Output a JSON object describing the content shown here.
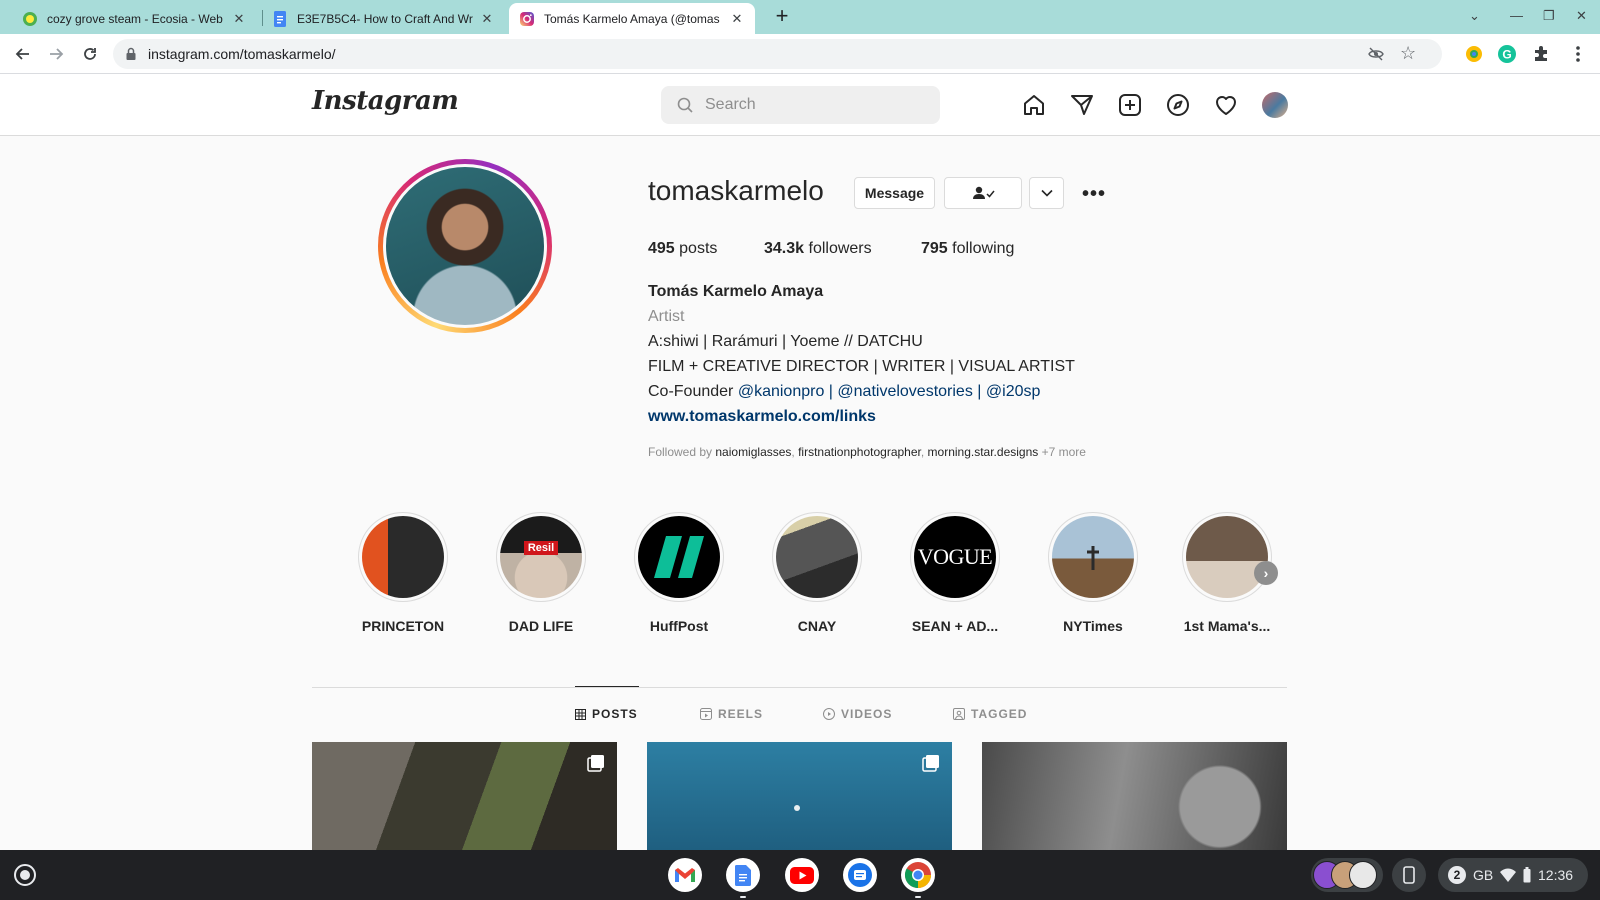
{
  "browser": {
    "tabs": [
      {
        "title": "cozy grove steam - Ecosia - Web",
        "favicon": "ecosia-icon"
      },
      {
        "title": "E3E7B5C4- How to Craft And Wr",
        "favicon": "docs-icon"
      },
      {
        "title": "Tomás Karmelo Amaya (@tomas",
        "favicon": "instagram-icon",
        "active": true
      }
    ],
    "url": "instagram.com/tomaskarmelo/"
  },
  "instagram": {
    "logo": "Instagram",
    "search_placeholder": "Search",
    "nav_icons": [
      "home-icon",
      "direct-icon",
      "new-post-icon",
      "explore-icon",
      "activity-heart-icon",
      "profile-avatar"
    ]
  },
  "profile": {
    "username": "tomaskarmelo",
    "message_label": "Message",
    "stats": {
      "posts_count": "495",
      "posts_label": "posts",
      "followers_count": "34.3k",
      "followers_label": "followers",
      "following_count": "795",
      "following_label": "following"
    },
    "full_name": "Tomás Karmelo Amaya",
    "category": "Artist",
    "bio_line1": "A:shiwi | Rarámuri | Yoeme // DATCHU",
    "bio_line2": "FILM + CREATIVE DIRECTOR | WRITER | VISUAL ARTIST",
    "bio_cofounder": "Co-Founder",
    "bio_mention1": "@kanionpro",
    "bio_sep1": "|",
    "bio_mention2": "@nativelovestories",
    "bio_sep2": "|",
    "bio_mention3": "@i20sp",
    "website": "www.tomaskarmelo.com/links",
    "followed_by_prefix": "Followed by",
    "followed_by_1": "naiomiglasses",
    "followed_by_2": "firstnationphotographer",
    "followed_by_3": "morning.star.designs",
    "followed_by_more": "+7 more"
  },
  "highlights": [
    {
      "label": "PRINCETON"
    },
    {
      "label": "DAD LIFE"
    },
    {
      "label": "HuffPost"
    },
    {
      "label": "CNAY"
    },
    {
      "label": "SEAN + AD..."
    },
    {
      "label": "NYTimes"
    },
    {
      "label": "1st Mama's..."
    }
  ],
  "highlight_marks": {
    "vogue": "VOGUE",
    "resilience": "Resil"
  },
  "profile_tabs": {
    "posts": "POSTS",
    "reels": "REELS",
    "videos": "VIDEOS",
    "tagged": "TAGGED"
  },
  "shelf": {
    "apps": [
      "gmail-icon",
      "docs-icon",
      "youtube-icon",
      "messages-icon",
      "chrome-icon"
    ],
    "notification_count": "2",
    "network_label": "GB",
    "time": "12:36"
  },
  "colors": {
    "tabstrip": "#a8dcd9",
    "ig_link": "#00376b",
    "ig_border": "#dbdbdb"
  }
}
